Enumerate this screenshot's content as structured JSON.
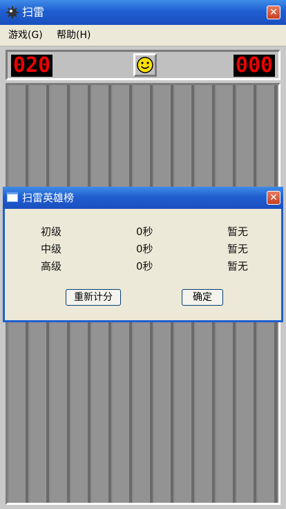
{
  "window": {
    "title": "扫雷"
  },
  "menu": {
    "items": [
      {
        "label": "游戏(G)"
      },
      {
        "label": "帮助(H)"
      }
    ]
  },
  "header": {
    "mine_counter": "020",
    "timer": "000"
  },
  "dialog": {
    "title": "扫雷英雄榜",
    "rows": [
      {
        "level": "初级",
        "time": "0秒",
        "name": "暂无"
      },
      {
        "level": "中级",
        "time": "0秒",
        "name": "暂无"
      },
      {
        "level": "高级",
        "time": "0秒",
        "name": "暂无"
      }
    ],
    "reset_label": "重新计分",
    "ok_label": "确定"
  },
  "colors": {
    "titlebar": "#1f5fd0",
    "lcd_digit": "#e00000",
    "smiley": "#ffe000"
  },
  "icons": {
    "app": "mine-icon",
    "close": "close-icon",
    "smiley": "smiley-face-icon",
    "dialog": "window-icon"
  }
}
